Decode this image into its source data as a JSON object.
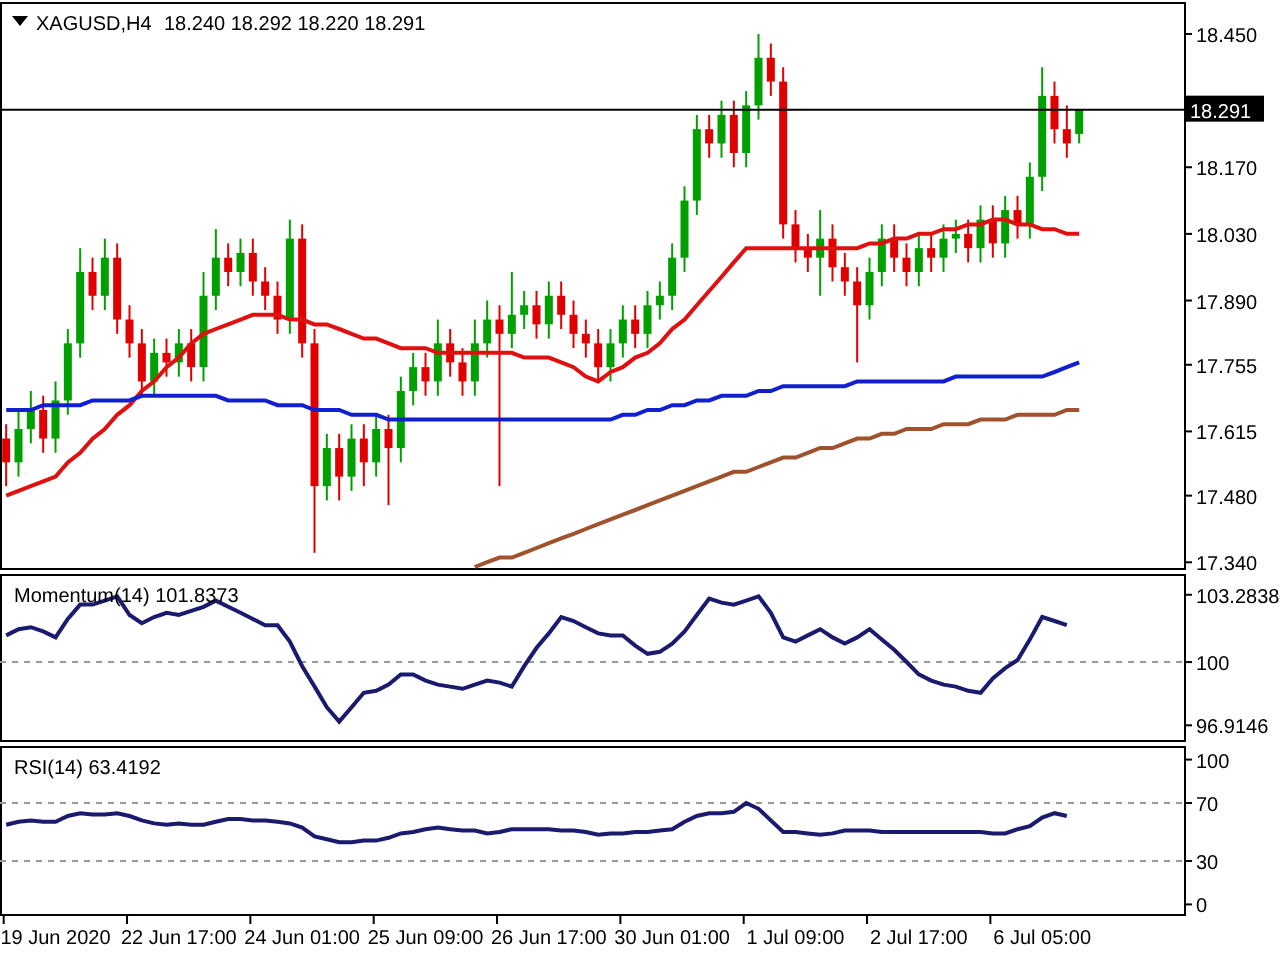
{
  "header": {
    "symbol": "XAGUSD,H4",
    "ohlc": "18.240 18.292 18.220 18.291"
  },
  "main": {
    "last_price": "18.291",
    "chart_data": {
      "type": "candlestick",
      "ylim": [
        17.328,
        18.513
      ],
      "yticks": [
        {
          "value": 18.45,
          "label": "18.450"
        },
        {
          "value": 18.17,
          "label": "18.170"
        },
        {
          "value": 18.03,
          "label": "18.030"
        },
        {
          "value": 17.89,
          "label": "17.890"
        },
        {
          "value": 17.755,
          "label": "17.755"
        },
        {
          "value": 17.615,
          "label": "17.615"
        },
        {
          "value": 17.48,
          "label": "17.480"
        },
        {
          "value": 17.34,
          "label": "17.340"
        }
      ],
      "ref_lines": [
        {
          "axis": "y",
          "value": 18.291
        }
      ],
      "series": [
        {
          "type": "line",
          "color": "#e01010",
          "values": [
            17.48,
            17.49,
            17.5,
            17.51,
            17.52,
            17.55,
            17.57,
            17.6,
            17.62,
            17.65,
            17.67,
            17.7,
            17.72,
            17.75,
            17.77,
            17.8,
            17.82,
            17.83,
            17.84,
            17.85,
            17.86,
            17.86,
            17.86,
            17.85,
            17.85,
            17.84,
            17.84,
            17.83,
            17.82,
            17.81,
            17.81,
            17.8,
            17.79,
            17.79,
            17.79,
            17.78,
            17.78,
            17.78,
            17.78,
            17.78,
            17.78,
            17.78,
            17.77,
            17.77,
            17.77,
            17.76,
            17.75,
            17.73,
            17.72,
            17.74,
            17.75,
            17.77,
            17.78,
            17.8,
            17.83,
            17.85,
            17.88,
            17.91,
            17.94,
            17.97,
            18.0,
            18.0,
            18.0,
            18.0,
            18.0,
            18.0,
            18.0,
            18.0,
            18.0,
            18.0,
            18.01,
            18.01,
            18.02,
            18.02,
            18.03,
            18.03,
            18.04,
            18.04,
            18.05,
            18.05,
            18.06,
            18.06,
            18.05,
            18.05,
            18.04,
            18.04,
            18.03,
            18.03,
            null,
            null,
            null,
            null,
            null,
            null,
            null,
            null
          ]
        },
        {
          "type": "line",
          "color": "#1020d0",
          "values": [
            17.66,
            17.66,
            17.66,
            17.67,
            17.67,
            17.67,
            17.67,
            17.68,
            17.68,
            17.68,
            17.68,
            17.69,
            17.69,
            17.69,
            17.69,
            17.69,
            17.69,
            17.69,
            17.68,
            17.68,
            17.68,
            17.68,
            17.67,
            17.67,
            17.67,
            17.66,
            17.66,
            17.66,
            17.65,
            17.65,
            17.65,
            17.64,
            17.64,
            17.64,
            17.64,
            17.64,
            17.64,
            17.64,
            17.64,
            17.64,
            17.64,
            17.64,
            17.64,
            17.64,
            17.64,
            17.64,
            17.64,
            17.64,
            17.64,
            17.64,
            17.65,
            17.65,
            17.66,
            17.66,
            17.67,
            17.67,
            17.68,
            17.68,
            17.69,
            17.69,
            17.69,
            17.7,
            17.7,
            17.71,
            17.71,
            17.71,
            17.71,
            17.71,
            17.71,
            17.72,
            17.72,
            17.72,
            17.72,
            17.72,
            17.72,
            17.72,
            17.72,
            17.73,
            17.73,
            17.73,
            17.73,
            17.73,
            17.73,
            17.73,
            17.73,
            17.74,
            17.75,
            17.76,
            null,
            null,
            null,
            null,
            null,
            null,
            null,
            null
          ]
        },
        {
          "type": "line",
          "color": "#a0522d",
          "values": [
            null,
            null,
            null,
            null,
            null,
            null,
            null,
            null,
            null,
            null,
            null,
            null,
            null,
            null,
            null,
            null,
            null,
            null,
            null,
            null,
            null,
            null,
            null,
            null,
            null,
            null,
            null,
            null,
            null,
            null,
            null,
            null,
            null,
            null,
            null,
            null,
            null,
            null,
            17.33,
            17.34,
            17.35,
            17.35,
            17.36,
            17.37,
            17.38,
            17.39,
            17.4,
            17.41,
            17.42,
            17.43,
            17.44,
            17.45,
            17.46,
            17.47,
            17.48,
            17.49,
            17.5,
            17.51,
            17.52,
            17.53,
            17.53,
            17.54,
            17.55,
            17.56,
            17.56,
            17.57,
            17.58,
            17.58,
            17.59,
            17.6,
            17.6,
            17.61,
            17.61,
            17.62,
            17.62,
            17.62,
            17.63,
            17.63,
            17.63,
            17.64,
            17.64,
            17.64,
            17.65,
            17.65,
            17.65,
            17.65,
            17.66,
            17.66,
            null,
            null,
            null,
            null,
            null,
            null,
            null,
            null
          ]
        }
      ],
      "categories": [
        null,
        null,
        null,
        null,
        null,
        null,
        null,
        null,
        null,
        null,
        null,
        null,
        null,
        null,
        null,
        null,
        null,
        null,
        null,
        null,
        null,
        null,
        null,
        null,
        null,
        null,
        null,
        null,
        null,
        null,
        null,
        null,
        null,
        null,
        null,
        null,
        null,
        null,
        null,
        null,
        null,
        null,
        null,
        null,
        null,
        null,
        null,
        null,
        null,
        null,
        null,
        null,
        null,
        null,
        null,
        null,
        null,
        null,
        null,
        null,
        null,
        null,
        null,
        null,
        null,
        null,
        null,
        null,
        null,
        null,
        null,
        null,
        null,
        null,
        null,
        null,
        null,
        null,
        null,
        null,
        null,
        null,
        null,
        null,
        null,
        null,
        null,
        null,
        null,
        null,
        null,
        null,
        null,
        null,
        null,
        null
      ],
      "ohlc": [
        [
          17.6,
          17.63,
          17.5,
          17.55
        ],
        [
          17.55,
          17.66,
          17.52,
          17.62
        ],
        [
          17.62,
          17.7,
          17.59,
          17.66
        ],
        [
          17.66,
          17.69,
          17.57,
          17.6
        ],
        [
          17.6,
          17.72,
          17.57,
          17.68
        ],
        [
          17.68,
          17.83,
          17.65,
          17.8
        ],
        [
          17.8,
          18.0,
          17.77,
          17.95
        ],
        [
          17.95,
          17.98,
          17.87,
          17.9
        ],
        [
          17.9,
          18.02,
          17.87,
          17.98
        ],
        [
          17.98,
          18.01,
          17.82,
          17.85
        ],
        [
          17.85,
          17.88,
          17.77,
          17.8
        ],
        [
          17.8,
          17.83,
          17.69,
          17.72
        ],
        [
          17.72,
          17.81,
          17.69,
          17.78
        ],
        [
          17.78,
          17.81,
          17.73,
          17.76
        ],
        [
          17.76,
          17.83,
          17.73,
          17.8
        ],
        [
          17.8,
          17.83,
          17.72,
          17.75
        ],
        [
          17.75,
          17.95,
          17.72,
          17.9
        ],
        [
          17.9,
          18.04,
          17.87,
          17.98
        ],
        [
          17.98,
          18.01,
          17.92,
          17.95
        ],
        [
          17.95,
          18.02,
          17.92,
          17.99
        ],
        [
          17.99,
          18.02,
          17.9,
          17.93
        ],
        [
          17.93,
          17.96,
          17.87,
          17.9
        ],
        [
          17.9,
          17.93,
          17.82,
          17.85
        ],
        [
          17.85,
          18.06,
          17.82,
          18.02
        ],
        [
          18.02,
          18.05,
          17.77,
          17.8
        ],
        [
          17.8,
          17.83,
          17.36,
          17.5
        ],
        [
          17.5,
          17.61,
          17.47,
          17.58
        ],
        [
          17.58,
          17.61,
          17.47,
          17.52
        ],
        [
          17.52,
          17.63,
          17.49,
          17.6
        ],
        [
          17.6,
          17.63,
          17.5,
          17.55
        ],
        [
          17.55,
          17.65,
          17.52,
          17.62
        ],
        [
          17.62,
          17.65,
          17.46,
          17.58
        ],
        [
          17.58,
          17.73,
          17.55,
          17.7
        ],
        [
          17.7,
          17.78,
          17.67,
          17.75
        ],
        [
          17.75,
          17.78,
          17.69,
          17.72
        ],
        [
          17.72,
          17.85,
          17.69,
          17.8
        ],
        [
          17.8,
          17.83,
          17.73,
          17.76
        ],
        [
          17.76,
          17.79,
          17.69,
          17.72
        ],
        [
          17.72,
          17.85,
          17.69,
          17.8
        ],
        [
          17.8,
          17.89,
          17.77,
          17.85
        ],
        [
          17.85,
          17.88,
          17.5,
          17.82
        ],
        [
          17.82,
          17.95,
          17.79,
          17.86
        ],
        [
          17.86,
          17.91,
          17.83,
          17.88
        ],
        [
          17.88,
          17.91,
          17.81,
          17.84
        ],
        [
          17.84,
          17.93,
          17.81,
          17.9
        ],
        [
          17.9,
          17.93,
          17.83,
          17.86
        ],
        [
          17.86,
          17.89,
          17.79,
          17.82
        ],
        [
          17.82,
          17.85,
          17.77,
          17.8
        ],
        [
          17.8,
          17.83,
          17.72,
          17.75
        ],
        [
          17.75,
          17.83,
          17.72,
          17.8
        ],
        [
          17.8,
          17.88,
          17.77,
          17.85
        ],
        [
          17.85,
          17.88,
          17.79,
          17.82
        ],
        [
          17.82,
          17.91,
          17.79,
          17.88
        ],
        [
          17.88,
          17.93,
          17.85,
          17.9
        ],
        [
          17.9,
          18.01,
          17.87,
          17.98
        ],
        [
          17.98,
          18.13,
          17.95,
          18.1
        ],
        [
          18.1,
          18.28,
          18.07,
          18.25
        ],
        [
          18.25,
          18.28,
          18.19,
          18.22
        ],
        [
          18.22,
          18.31,
          18.19,
          18.28
        ],
        [
          18.28,
          18.31,
          18.17,
          18.2
        ],
        [
          18.2,
          18.33,
          18.17,
          18.3
        ],
        [
          18.3,
          18.45,
          18.27,
          18.4
        ],
        [
          18.4,
          18.43,
          18.32,
          18.35
        ],
        [
          18.35,
          18.38,
          18.02,
          18.05
        ],
        [
          18.05,
          18.08,
          17.97,
          18.0
        ],
        [
          18.0,
          18.03,
          17.95,
          17.98
        ],
        [
          17.98,
          18.08,
          17.9,
          18.02
        ],
        [
          18.02,
          18.05,
          17.93,
          17.96
        ],
        [
          17.96,
          17.99,
          17.9,
          17.93
        ],
        [
          17.93,
          17.96,
          17.76,
          17.88
        ],
        [
          17.88,
          17.98,
          17.85,
          17.95
        ],
        [
          17.95,
          18.05,
          17.92,
          18.02
        ],
        [
          18.02,
          18.05,
          17.95,
          17.98
        ],
        [
          17.98,
          18.01,
          17.92,
          17.95
        ],
        [
          17.95,
          18.03,
          17.92,
          18.0
        ],
        [
          18.0,
          18.03,
          17.95,
          17.98
        ],
        [
          17.98,
          18.05,
          17.95,
          18.02
        ],
        [
          18.02,
          18.06,
          17.99,
          18.03
        ],
        [
          18.03,
          18.06,
          17.97,
          18.0
        ],
        [
          18.0,
          18.09,
          17.97,
          18.06
        ],
        [
          18.06,
          18.09,
          17.98,
          18.01
        ],
        [
          18.01,
          18.11,
          17.98,
          18.08
        ],
        [
          18.08,
          18.11,
          18.02,
          18.05
        ],
        [
          18.05,
          18.18,
          18.02,
          18.15
        ],
        [
          18.15,
          18.38,
          18.12,
          18.32
        ],
        [
          18.32,
          18.35,
          18.22,
          18.25
        ],
        [
          18.25,
          18.3,
          18.19,
          18.22
        ],
        [
          18.24,
          18.292,
          18.22,
          18.291
        ],
        null,
        null,
        null,
        null,
        null,
        null,
        null,
        null
      ]
    }
  },
  "momentum": {
    "title": "Momentum(14) 101.8373",
    "chart_data": {
      "type": "line",
      "ylim": [
        96.1,
        104.2
      ],
      "yticks": [
        {
          "value": 103.2838,
          "label": "103.2838"
        },
        100,
        {
          "value": 96.9146,
          "label": "96.9146"
        }
      ],
      "ref_lines": [
        {
          "axis": "y",
          "value": 100
        }
      ],
      "categories": [
        null,
        null,
        null,
        null,
        null,
        null,
        null,
        null,
        null,
        null,
        null,
        null,
        null,
        null,
        null,
        null,
        null,
        null,
        null,
        null,
        null,
        null,
        null,
        null,
        null,
        null,
        null,
        null,
        null,
        null,
        null,
        null,
        null,
        null,
        null,
        null,
        null,
        null,
        null,
        null,
        null,
        null,
        null,
        null,
        null,
        null,
        null,
        null,
        null,
        null,
        null,
        null,
        null,
        null,
        null,
        null,
        null,
        null,
        null,
        null,
        null,
        null,
        null,
        null,
        null,
        null,
        null,
        null,
        null,
        null,
        null,
        null,
        null,
        null,
        null,
        null,
        null,
        null,
        null,
        null,
        null,
        null,
        null,
        null,
        null,
        null,
        null,
        null,
        null,
        null,
        null,
        null,
        null,
        null,
        null,
        null
      ],
      "series": [
        {
          "color": "#1a1a6e",
          "values": [
            101.3,
            101.6,
            101.7,
            101.5,
            101.2,
            102.1,
            102.8,
            102.8,
            103.0,
            103.2,
            102.3,
            101.9,
            102.2,
            102.4,
            102.3,
            102.5,
            102.7,
            103.0,
            102.7,
            102.4,
            102.1,
            101.8,
            101.8,
            101.0,
            99.8,
            98.8,
            97.8,
            97.1,
            97.8,
            98.5,
            98.6,
            98.9,
            99.4,
            99.4,
            99.1,
            98.9,
            98.8,
            98.7,
            98.9,
            99.1,
            99.0,
            98.8,
            99.8,
            100.7,
            101.4,
            102.2,
            102.0,
            101.7,
            101.4,
            101.3,
            101.3,
            100.8,
            100.4,
            100.5,
            100.9,
            101.5,
            102.3,
            103.1,
            102.9,
            102.8,
            103.0,
            103.2,
            102.4,
            101.2,
            101.0,
            101.3,
            101.6,
            101.2,
            100.9,
            101.2,
            101.6,
            101.1,
            100.6,
            100.0,
            99.4,
            99.1,
            98.9,
            98.8,
            98.6,
            98.5,
            99.2,
            99.7,
            100.1,
            101.1,
            102.2,
            102.0,
            101.8,
            null,
            null,
            null,
            null,
            null,
            null,
            null,
            null,
            null
          ]
        }
      ]
    }
  },
  "rsi": {
    "title": "RSI(14) 63.4192",
    "chart_data": {
      "type": "line",
      "ylim": [
        -8,
        108
      ],
      "yticks": [
        100,
        70,
        30,
        0
      ],
      "ref_lines": [
        {
          "axis": "y",
          "value": 70
        },
        {
          "axis": "y",
          "value": 30
        }
      ],
      "categories": [
        null,
        null,
        null,
        null,
        "19 Jun 2020",
        null,
        null,
        null,
        null,
        null,
        null,
        null,
        null,
        null,
        "22 Jun 17:00",
        null,
        null,
        null,
        null,
        null,
        null,
        null,
        null,
        null,
        "24 Jun 01:00",
        null,
        null,
        null,
        null,
        null,
        null,
        null,
        null,
        null,
        "25 Jun 09:00",
        null,
        null,
        null,
        null,
        null,
        null,
        null,
        null,
        null,
        "26 Jun 17:00",
        null,
        null,
        null,
        null,
        null,
        null,
        null,
        null,
        null,
        "30 Jun 01:00",
        null,
        null,
        null,
        null,
        null,
        null,
        null,
        null,
        null,
        "1 Jul 09:00",
        null,
        null,
        null,
        null,
        null,
        null,
        null,
        null,
        null,
        "2 Jul 17:00",
        null,
        null,
        null,
        null,
        null,
        null,
        null,
        null,
        null,
        "6 Jul 05:00",
        null,
        null,
        null,
        null,
        null,
        null,
        null,
        null,
        null,
        null,
        null
      ],
      "series": [
        {
          "color": "#1a1a6e",
          "values": [
            55,
            57,
            58,
            57,
            57,
            61,
            63,
            62,
            62,
            63,
            61,
            58,
            56,
            55,
            56,
            55,
            55,
            57,
            59,
            59,
            58,
            58,
            57,
            56,
            53,
            47,
            45,
            43,
            43,
            44,
            44,
            46,
            49,
            50,
            52,
            53,
            52,
            51,
            51,
            49,
            50,
            52,
            52,
            52,
            52,
            51,
            51,
            50,
            48,
            49,
            49,
            50,
            50,
            51,
            52,
            57,
            61,
            63,
            63,
            64,
            70,
            66,
            58,
            50,
            50,
            49,
            48,
            49,
            51,
            51,
            51,
            50,
            50,
            50,
            50,
            50,
            50,
            50,
            50,
            50,
            49,
            49,
            52,
            54,
            60,
            63,
            61,
            null,
            null,
            null,
            null,
            null,
            null,
            null,
            null,
            null
          ]
        }
      ]
    }
  }
}
